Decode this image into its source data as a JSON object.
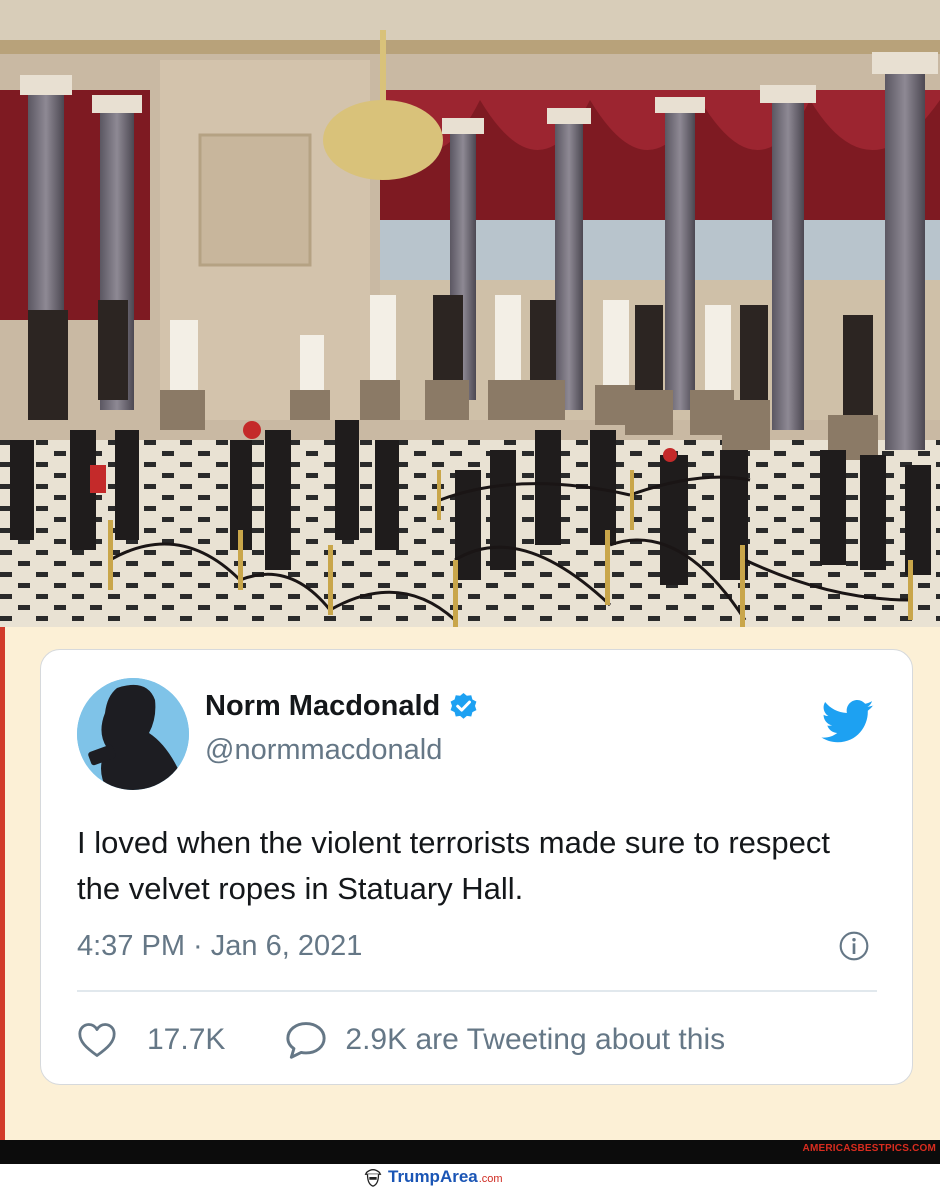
{
  "photo": {
    "alt": "Statuary Hall photo"
  },
  "tweet": {
    "name": "Norm Macdonald",
    "handle": "@normmacdonald",
    "text": "I loved when the violent terrorists made sure to respect the velvet ropes in Statuary Hall.",
    "timestamp": "4:37 PM · Jan 6, 2021",
    "likes": "17.7K",
    "tweeting": "2.9K are Tweeting about this",
    "icons": {
      "verified": "verified-badge-icon",
      "twitter": "twitter-bird-icon",
      "info": "info-icon",
      "like": "heart-icon",
      "reply": "speech-bubble-icon"
    },
    "colors": {
      "twitter_blue": "#1da1f2",
      "text": "#14171a",
      "muted": "#657786"
    }
  },
  "watermarks": {
    "americasbest": "AMERICASBESTPICS.COM",
    "trumparea_name": "TrumpArea",
    "trumparea_tld": ".com"
  }
}
